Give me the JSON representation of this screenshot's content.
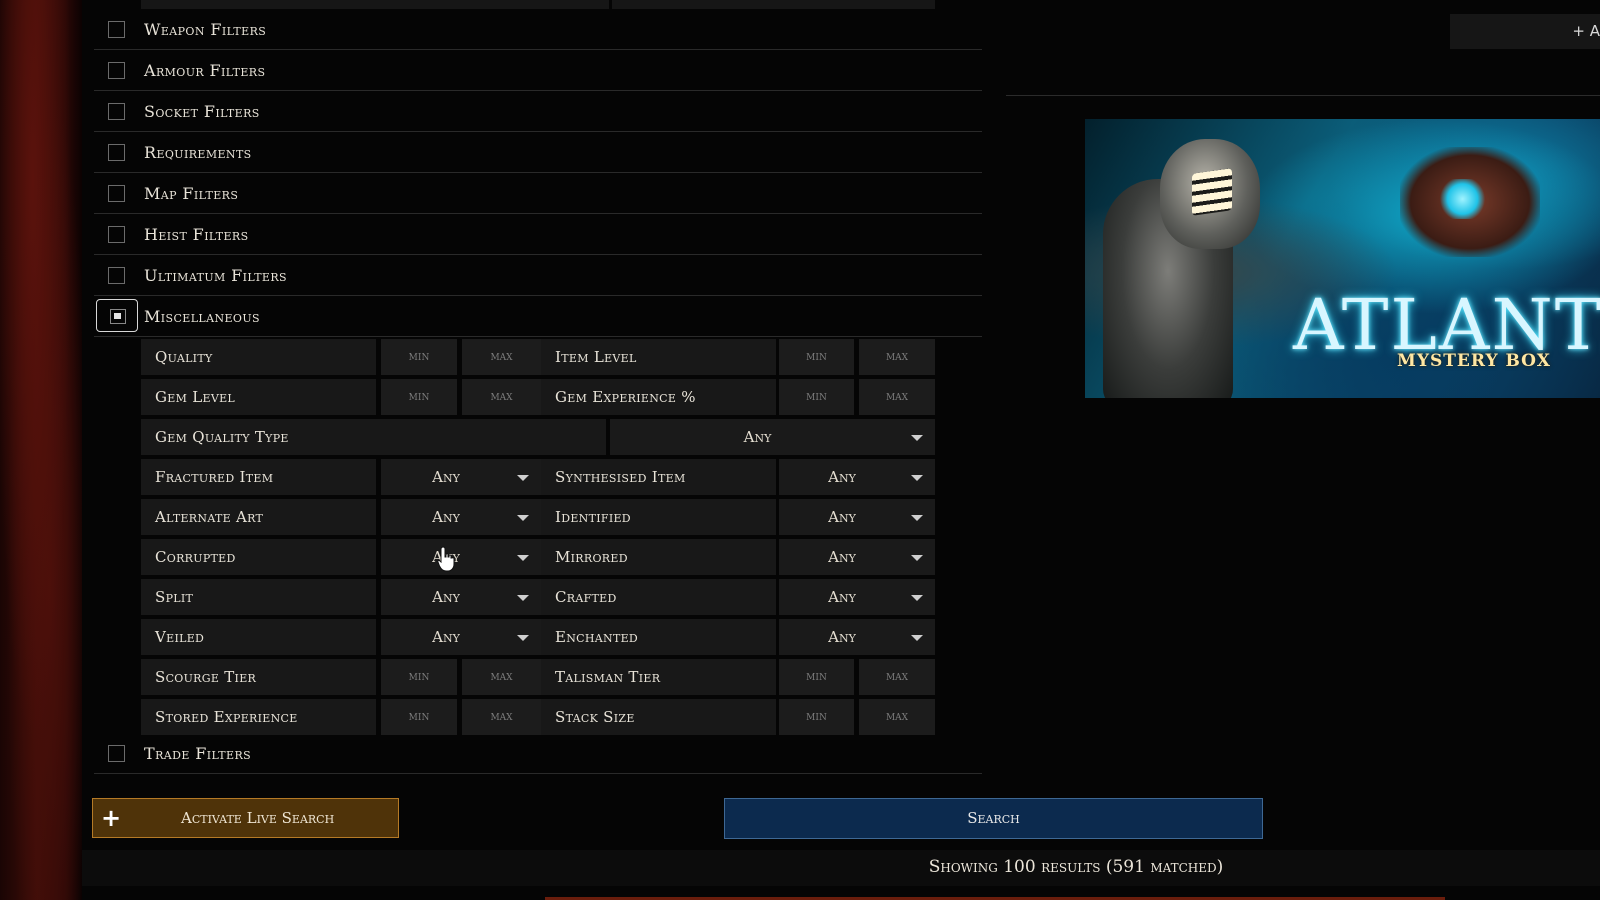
{
  "filter_groups": {
    "weapon": "Weapon Filters",
    "armour": "Armour Filters",
    "socket": "Socket Filters",
    "requirements": "Requirements",
    "map": "Map Filters",
    "heist": "Heist Filters",
    "ultimatum": "Ultimatum Filters",
    "misc": "Miscellaneous",
    "trade": "Trade Filters"
  },
  "misc": {
    "min_placeholder": "min",
    "max_placeholder": "max",
    "quality": "Quality",
    "item_level": "Item Level",
    "gem_level": "Gem Level",
    "gem_experience": "Gem Experience %",
    "gem_quality_type": "Gem Quality Type",
    "gem_quality_value": "Any",
    "fractured_item": "Fractured Item",
    "fractured_value": "Any",
    "synthesised_item": "Synthesised Item",
    "synthesised_value": "Any",
    "alternate_art": "Alternate Art",
    "alternate_art_value": "Any",
    "identified": "Identified",
    "identified_value": "Any",
    "corrupted": "Corrupted",
    "corrupted_value": "Any",
    "mirrored": "Mirrored",
    "mirrored_value": "Any",
    "split": "Split",
    "split_value": "Any",
    "crafted": "Crafted",
    "crafted_value": "Any",
    "veiled": "Veiled",
    "veiled_value": "Any",
    "enchanted": "Enchanted",
    "enchanted_value": "Any",
    "scourge_tier": "Scourge Tier",
    "talisman_tier": "Talisman Tier",
    "stored_experience": "Stored Experience",
    "stack_size": "Stack Size"
  },
  "actions": {
    "live_search": "Activate Live Search",
    "live_plus": "+",
    "search": "Search",
    "top_right": "+ A"
  },
  "results": {
    "summary": "Showing 100 results (591 matched)"
  },
  "banner": {
    "title": "ATLANTIS",
    "subtitle": "MYSTERY BOX"
  },
  "colors": {
    "live_search_bg": "#4f3309",
    "search_bg": "#0c2a4e",
    "panel_bg": "#181818"
  }
}
